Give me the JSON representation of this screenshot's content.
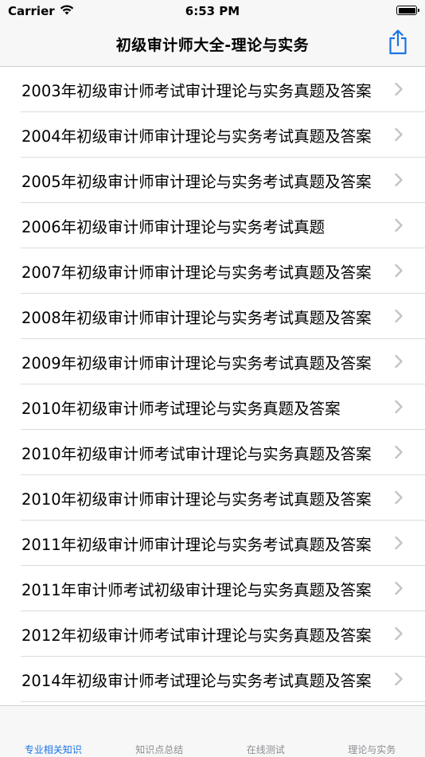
{
  "status_bar": {
    "carrier": "Carrier",
    "time": "6:53 PM"
  },
  "nav": {
    "title": "初级审计师大全-理论与实务",
    "share_icon": "share-icon"
  },
  "list": {
    "items": [
      {
        "label": "2003年初级审计师考试审计理论与实务真题及答案"
      },
      {
        "label": "2004年初级审计师审计理论与实务考试真题及答案"
      },
      {
        "label": "2005年初级审计师审计理论与实务考试真题及答案"
      },
      {
        "label": "2006年初级审计师审计理论与实务考试真题"
      },
      {
        "label": "2007年初级审计师审计理论与实务考试真题及答案"
      },
      {
        "label": "2008年初级审计师审计理论与实务考试真题及答案"
      },
      {
        "label": "2009年初级审计师审计理论与实务考试真题及答案"
      },
      {
        "label": "2010年初级审计师考试理论与实务真题及答案"
      },
      {
        "label": "2010年初级审计师考试审计理论与实务真题及答案"
      },
      {
        "label": "2010年初级审计师审计理论与实务考试真题及答案"
      },
      {
        "label": "2011年初级审计师审计理论与实务考试真题及答案"
      },
      {
        "label": "2011年审计师考试初级审计理论与实务真题及答案"
      },
      {
        "label": "2012年初级审计师考试审计理论与实务真题及答案"
      },
      {
        "label": "2014年初级审计师考试理论与实务考试真题及答案"
      }
    ]
  },
  "tabs": [
    {
      "label": "专业相关知识",
      "active": true
    },
    {
      "label": "知识点总结",
      "active": false
    },
    {
      "label": "在线测试",
      "active": false
    },
    {
      "label": "理论与实务",
      "active": false
    }
  ],
  "colors": {
    "accent": "#1a73e8",
    "chevron": "#c4c4c7",
    "inactive_tab": "#8e8e93"
  }
}
